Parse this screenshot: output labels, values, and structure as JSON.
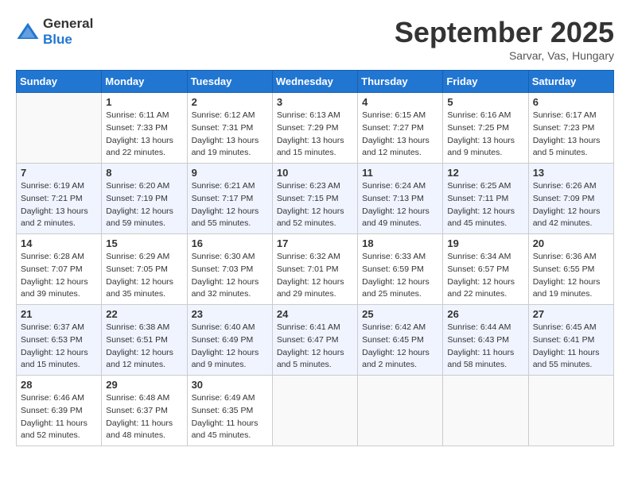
{
  "logo": {
    "general": "General",
    "blue": "Blue"
  },
  "title": "September 2025",
  "location": "Sarvar, Vas, Hungary",
  "weekdays": [
    "Sunday",
    "Monday",
    "Tuesday",
    "Wednesday",
    "Thursday",
    "Friday",
    "Saturday"
  ],
  "weeks": [
    [
      {
        "day": "",
        "info": ""
      },
      {
        "day": "1",
        "info": "Sunrise: 6:11 AM\nSunset: 7:33 PM\nDaylight: 13 hours\nand 22 minutes."
      },
      {
        "day": "2",
        "info": "Sunrise: 6:12 AM\nSunset: 7:31 PM\nDaylight: 13 hours\nand 19 minutes."
      },
      {
        "day": "3",
        "info": "Sunrise: 6:13 AM\nSunset: 7:29 PM\nDaylight: 13 hours\nand 15 minutes."
      },
      {
        "day": "4",
        "info": "Sunrise: 6:15 AM\nSunset: 7:27 PM\nDaylight: 13 hours\nand 12 minutes."
      },
      {
        "day": "5",
        "info": "Sunrise: 6:16 AM\nSunset: 7:25 PM\nDaylight: 13 hours\nand 9 minutes."
      },
      {
        "day": "6",
        "info": "Sunrise: 6:17 AM\nSunset: 7:23 PM\nDaylight: 13 hours\nand 5 minutes."
      }
    ],
    [
      {
        "day": "7",
        "info": "Sunrise: 6:19 AM\nSunset: 7:21 PM\nDaylight: 13 hours\nand 2 minutes."
      },
      {
        "day": "8",
        "info": "Sunrise: 6:20 AM\nSunset: 7:19 PM\nDaylight: 12 hours\nand 59 minutes."
      },
      {
        "day": "9",
        "info": "Sunrise: 6:21 AM\nSunset: 7:17 PM\nDaylight: 12 hours\nand 55 minutes."
      },
      {
        "day": "10",
        "info": "Sunrise: 6:23 AM\nSunset: 7:15 PM\nDaylight: 12 hours\nand 52 minutes."
      },
      {
        "day": "11",
        "info": "Sunrise: 6:24 AM\nSunset: 7:13 PM\nDaylight: 12 hours\nand 49 minutes."
      },
      {
        "day": "12",
        "info": "Sunrise: 6:25 AM\nSunset: 7:11 PM\nDaylight: 12 hours\nand 45 minutes."
      },
      {
        "day": "13",
        "info": "Sunrise: 6:26 AM\nSunset: 7:09 PM\nDaylight: 12 hours\nand 42 minutes."
      }
    ],
    [
      {
        "day": "14",
        "info": "Sunrise: 6:28 AM\nSunset: 7:07 PM\nDaylight: 12 hours\nand 39 minutes."
      },
      {
        "day": "15",
        "info": "Sunrise: 6:29 AM\nSunset: 7:05 PM\nDaylight: 12 hours\nand 35 minutes."
      },
      {
        "day": "16",
        "info": "Sunrise: 6:30 AM\nSunset: 7:03 PM\nDaylight: 12 hours\nand 32 minutes."
      },
      {
        "day": "17",
        "info": "Sunrise: 6:32 AM\nSunset: 7:01 PM\nDaylight: 12 hours\nand 29 minutes."
      },
      {
        "day": "18",
        "info": "Sunrise: 6:33 AM\nSunset: 6:59 PM\nDaylight: 12 hours\nand 25 minutes."
      },
      {
        "day": "19",
        "info": "Sunrise: 6:34 AM\nSunset: 6:57 PM\nDaylight: 12 hours\nand 22 minutes."
      },
      {
        "day": "20",
        "info": "Sunrise: 6:36 AM\nSunset: 6:55 PM\nDaylight: 12 hours\nand 19 minutes."
      }
    ],
    [
      {
        "day": "21",
        "info": "Sunrise: 6:37 AM\nSunset: 6:53 PM\nDaylight: 12 hours\nand 15 minutes."
      },
      {
        "day": "22",
        "info": "Sunrise: 6:38 AM\nSunset: 6:51 PM\nDaylight: 12 hours\nand 12 minutes."
      },
      {
        "day": "23",
        "info": "Sunrise: 6:40 AM\nSunset: 6:49 PM\nDaylight: 12 hours\nand 9 minutes."
      },
      {
        "day": "24",
        "info": "Sunrise: 6:41 AM\nSunset: 6:47 PM\nDaylight: 12 hours\nand 5 minutes."
      },
      {
        "day": "25",
        "info": "Sunrise: 6:42 AM\nSunset: 6:45 PM\nDaylight: 12 hours\nand 2 minutes."
      },
      {
        "day": "26",
        "info": "Sunrise: 6:44 AM\nSunset: 6:43 PM\nDaylight: 11 hours\nand 58 minutes."
      },
      {
        "day": "27",
        "info": "Sunrise: 6:45 AM\nSunset: 6:41 PM\nDaylight: 11 hours\nand 55 minutes."
      }
    ],
    [
      {
        "day": "28",
        "info": "Sunrise: 6:46 AM\nSunset: 6:39 PM\nDaylight: 11 hours\nand 52 minutes."
      },
      {
        "day": "29",
        "info": "Sunrise: 6:48 AM\nSunset: 6:37 PM\nDaylight: 11 hours\nand 48 minutes."
      },
      {
        "day": "30",
        "info": "Sunrise: 6:49 AM\nSunset: 6:35 PM\nDaylight: 11 hours\nand 45 minutes."
      },
      {
        "day": "",
        "info": ""
      },
      {
        "day": "",
        "info": ""
      },
      {
        "day": "",
        "info": ""
      },
      {
        "day": "",
        "info": ""
      }
    ]
  ]
}
